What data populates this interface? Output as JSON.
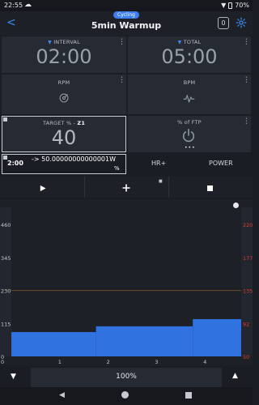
{
  "status": {
    "time": "22:55",
    "battery": "70%"
  },
  "header": {
    "badge": "Cycling",
    "title": "5min Warmup",
    "lap_count": "0"
  },
  "tiles": {
    "interval": {
      "label": "INTERVAL",
      "value": "02:00"
    },
    "total": {
      "label": "TOTAL",
      "value": "05:00"
    },
    "rpm": {
      "label": "RPM"
    },
    "bpm": {
      "label": "BPM"
    },
    "target": {
      "label": "TARGET % -",
      "zone": "Z1",
      "value": "40"
    },
    "ftp": {
      "label": "% of FTP"
    }
  },
  "step": {
    "duration": "2:00",
    "target": "-> 50.00000000000001W",
    "unit": "%"
  },
  "modes": {
    "hr": "HR+",
    "power": "POWER"
  },
  "zoom": "100%",
  "icons": {
    "play": "play-icon",
    "add": "plus-icon",
    "stop": "stop-icon",
    "lock": "lock-icon"
  },
  "colors": {
    "accent": "#3b8cf3",
    "bar": "#2f72e0",
    "hr_axis": "#e03a3a",
    "line": "#6b4a2a"
  },
  "chart_data": {
    "type": "bar",
    "x_ticks": [
      "0",
      "1",
      "2",
      "3",
      "4"
    ],
    "left_ticks": [
      "460",
      "345",
      "230",
      "115",
      "0"
    ],
    "right_ticks": [
      "220",
      "177",
      "135",
      "92",
      "50"
    ],
    "segments": [
      {
        "x0": 0,
        "x1": 1.75,
        "y": 85
      },
      {
        "x0": 1.75,
        "x1": 3.75,
        "y": 105
      },
      {
        "x0": 3.75,
        "x1": 4.75,
        "y": 130
      }
    ],
    "xlim": [
      0,
      4.75
    ],
    "ylim": [
      0,
      520
    ],
    "reference_line": 230
  }
}
